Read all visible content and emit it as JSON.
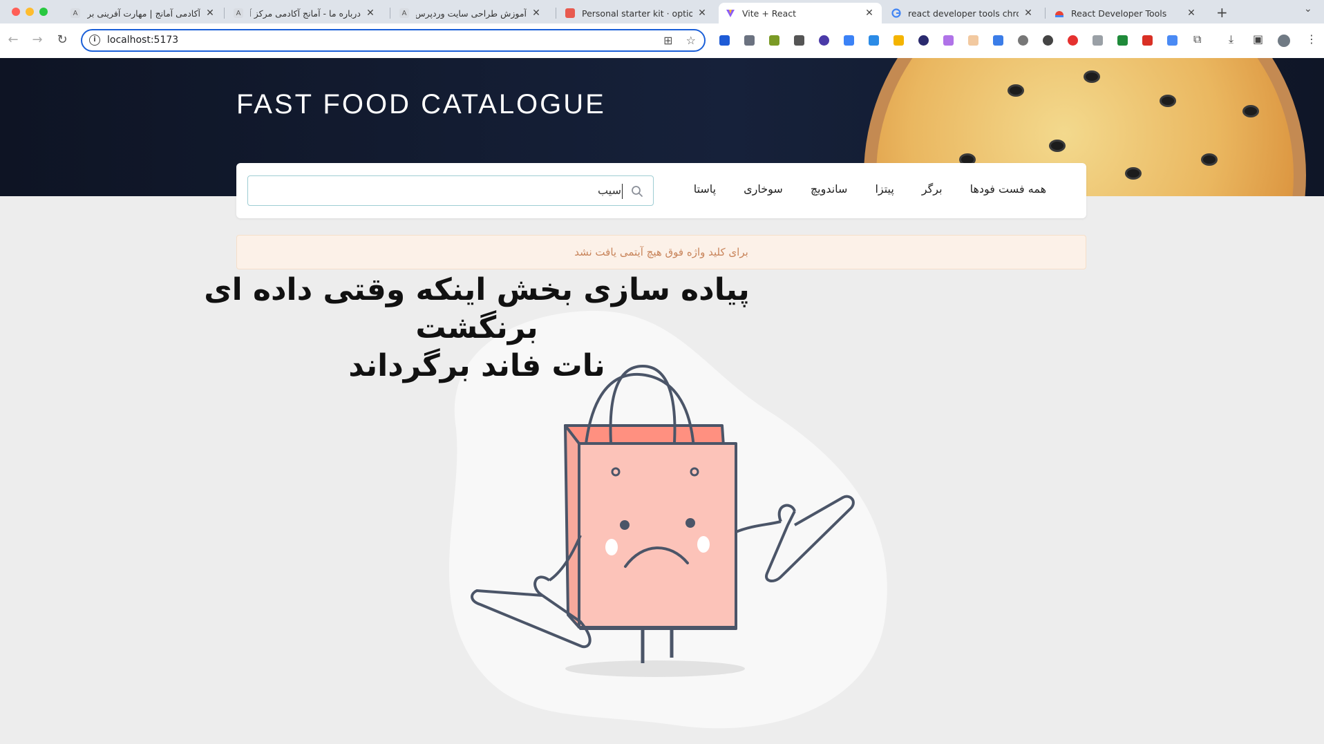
{
  "browser": {
    "tabs": [
      {
        "title": "آکادمی آمانج | مهارت آفرینی برای و",
        "favicon": "amanj-icon"
      },
      {
        "title": "درباره ما - آمانج آکادمی مرکز آموزش",
        "favicon": "amanj-icon"
      },
      {
        "title": "آموزش طراحی سایت وردپرس جامع",
        "favicon": "amanj-icon"
      },
      {
        "title": "Personal starter kit · optional",
        "favicon": "kit-icon"
      },
      {
        "title": "Vite + React",
        "favicon": "vite-icon"
      },
      {
        "title": "react developer tools chrome",
        "favicon": "google-icon"
      },
      {
        "title": "React Developer Tools",
        "favicon": "webstore-icon"
      }
    ],
    "active_tab": 4,
    "url": "localhost:5173"
  },
  "header": {
    "title": "FAST FOOD CATALOGUE"
  },
  "categories": [
    "همه فست فودها",
    "برگر",
    "پیتزا",
    "ساندویچ",
    "سوخاری",
    "پاستا"
  ],
  "search": {
    "value": "سیب"
  },
  "alert": {
    "text": "برای کلید واژه فوق هیچ آیتمی یافت نشد",
    "color": "#c8845a"
  },
  "annotation": {
    "line1": "پیاده سازی بخش  اینکه وقتی داده ای برنگشت",
    "line2": "نات فاند برگرداند"
  },
  "colors": {
    "hero_bg": "#0e1424",
    "page_bg": "#ededed",
    "bag": "#fbc3b9",
    "bag_outline": "#4b5568",
    "alert_bg": "#fcf1e8"
  }
}
